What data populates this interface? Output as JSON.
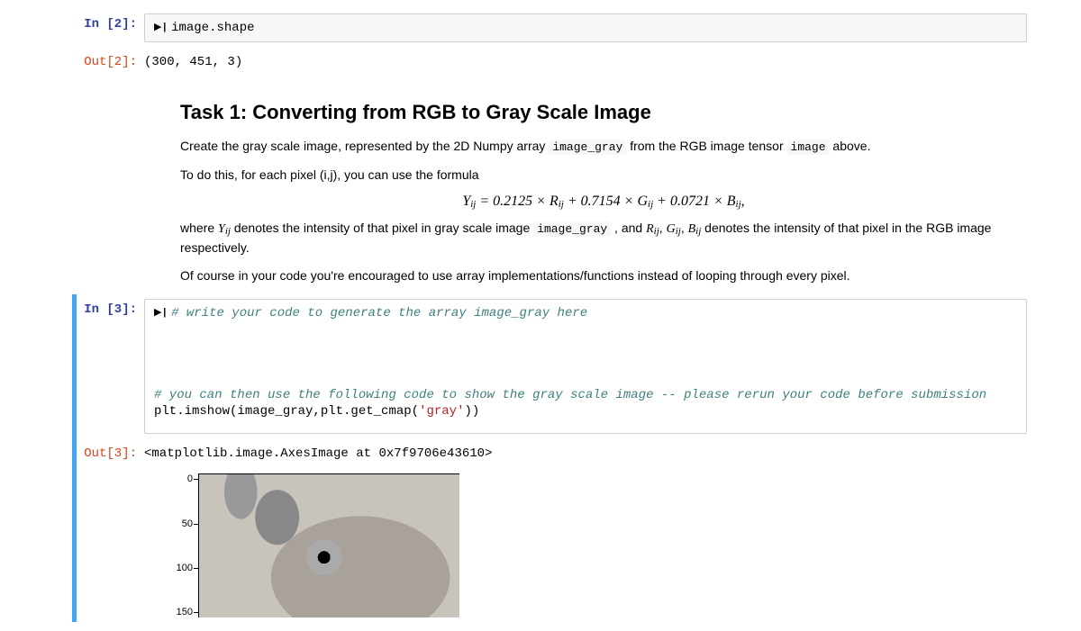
{
  "cell2": {
    "in_prompt": "In [2]:",
    "code": "image.shape",
    "out_prompt": "Out[2]:",
    "output": "(300, 451, 3)"
  },
  "md": {
    "heading": "Task 1: Converting from RGB to Gray Scale Image",
    "p1_a": "Create the gray scale image, represented by the 2D Numpy array ",
    "p1_code1": "image_gray",
    "p1_b": " from the RGB image tensor ",
    "p1_code2": "image",
    "p1_c": " above.",
    "p2": "To do this, for each pixel (i,j), you can use the formula",
    "formula": "Yᵢⱼ = 0.2125 × Rᵢⱼ + 0.7154 × Gᵢⱼ + 0.0721 × Bᵢⱼ,",
    "p3_a": "where ",
    "p3_y": "Yᵢⱼ",
    "p3_b": " denotes the intensity of that pixel in gray scale image ",
    "p3_code": "image_gray",
    "p3_c": " , and ",
    "p3_r": "Rᵢⱼ",
    "p3_g": "Gᵢⱼ",
    "p3_bi": "Bᵢⱼ",
    "p3_d": " denotes the intensity of that pixel in the RGB image respectively.",
    "p4": "Of course in your code you're encouraged to use array implementations/functions instead of looping through every pixel."
  },
  "cell3": {
    "in_prompt": "In [3]:",
    "line1": "# write your code to generate the array image_gray here",
    "line2": "# you can then use the following code to show the gray scale image -- please rerun your code before submission",
    "line3a": "plt.imshow(image_gray,plt.get_cmap(",
    "line3b": "'gray'",
    "line3c": "))",
    "out_prompt": "Out[3]:",
    "output": "<matplotlib.image.AxesImage at 0x7f9706e43610>"
  },
  "plot": {
    "yticks": [
      "0",
      "50",
      "100",
      "150"
    ]
  },
  "run_glyph": "▶|"
}
